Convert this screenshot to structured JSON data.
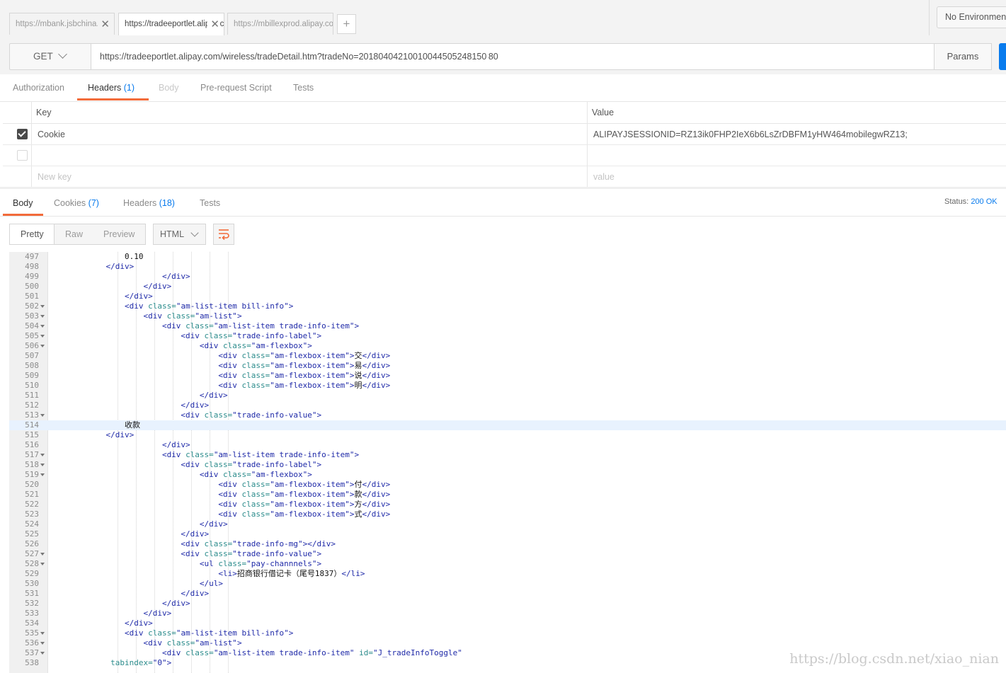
{
  "tabs": [
    {
      "label": "https://mbank.jsbchina.cn"
    },
    {
      "label": "https://tradeeportlet.alipay.com"
    },
    {
      "label": "https://mbillexprod.alipay.com"
    }
  ],
  "new_tab_label": "+",
  "close_glyph": "✕",
  "environment": "No Environment",
  "request": {
    "method": "GET",
    "url": "https://tradeeportlet.alipay.com/wireless/tradeDetail.htm?tradeNo=20180404210010044505248150 80",
    "params_label": "Params"
  },
  "request_tabs": {
    "authorization": "Authorization",
    "headers": "Headers",
    "headers_count": "(1)",
    "body": "Body",
    "prerequest": "Pre-request Script",
    "tests": "Tests"
  },
  "headers_table": {
    "key_header": "Key",
    "value_header": "Value",
    "rows": [
      {
        "key": "Cookie",
        "value": "ALIPAYJSESSIONID=RZ13ik0FHP2IeX6b6LsZrDBFM1yHW464mobilegwRZ13;",
        "checked": true
      }
    ],
    "new_key_placeholder": "New key",
    "value_placeholder": "value"
  },
  "response_tabs": {
    "body": "Body",
    "cookies": "Cookies",
    "cookies_count": "(7)",
    "headers": "Headers",
    "headers_count": "(18)",
    "tests": "Tests"
  },
  "status": {
    "label": "Status:",
    "value": "200 OK"
  },
  "view_modes": [
    "Pretty",
    "Raw",
    "Preview"
  ],
  "language": "HTML",
  "code_lines": [
    {
      "n": "497",
      "f": false,
      "c": [
        [
          "pl",
          "                0.10"
        ]
      ]
    },
    {
      "n": "498",
      "f": false,
      "c": [
        [
          "tg",
          "            </div>"
        ]
      ]
    },
    {
      "n": "499",
      "f": false,
      "c": [
        [
          "tg",
          "                        </div>"
        ]
      ]
    },
    {
      "n": "500",
      "f": false,
      "c": [
        [
          "tg",
          "                    </div>"
        ]
      ]
    },
    {
      "n": "501",
      "f": false,
      "c": [
        [
          "tg",
          "                </div>"
        ]
      ]
    },
    {
      "n": "502",
      "f": true,
      "c": [
        [
          "tg",
          "                <div "
        ],
        [
          "at",
          "class="
        ],
        [
          "st",
          "\"am-list-item bill-info\""
        ],
        [
          "tg",
          ">"
        ]
      ]
    },
    {
      "n": "503",
      "f": true,
      "c": [
        [
          "tg",
          "                    <div "
        ],
        [
          "at",
          "class="
        ],
        [
          "st",
          "\"am-list\""
        ],
        [
          "tg",
          ">"
        ]
      ]
    },
    {
      "n": "504",
      "f": true,
      "c": [
        [
          "tg",
          "                        <div "
        ],
        [
          "at",
          "class="
        ],
        [
          "st",
          "\"am-list-item trade-info-item\""
        ],
        [
          "tg",
          ">"
        ]
      ]
    },
    {
      "n": "505",
      "f": true,
      "c": [
        [
          "tg",
          "                            <div "
        ],
        [
          "at",
          "class="
        ],
        [
          "st",
          "\"trade-info-label\""
        ],
        [
          "tg",
          ">"
        ]
      ]
    },
    {
      "n": "506",
      "f": true,
      "c": [
        [
          "tg",
          "                                <div "
        ],
        [
          "at",
          "class="
        ],
        [
          "st",
          "\"am-flexbox\""
        ],
        [
          "tg",
          ">"
        ]
      ]
    },
    {
      "n": "507",
      "f": false,
      "c": [
        [
          "tg",
          "                                    <div "
        ],
        [
          "at",
          "class="
        ],
        [
          "st",
          "\"am-flexbox-item\""
        ],
        [
          "tg",
          ">"
        ],
        [
          "pl",
          "交"
        ],
        [
          "tg",
          "</div>"
        ]
      ]
    },
    {
      "n": "508",
      "f": false,
      "c": [
        [
          "tg",
          "                                    <div "
        ],
        [
          "at",
          "class="
        ],
        [
          "st",
          "\"am-flexbox-item\""
        ],
        [
          "tg",
          ">"
        ],
        [
          "pl",
          "易"
        ],
        [
          "tg",
          "</div>"
        ]
      ]
    },
    {
      "n": "509",
      "f": false,
      "c": [
        [
          "tg",
          "                                    <div "
        ],
        [
          "at",
          "class="
        ],
        [
          "st",
          "\"am-flexbox-item\""
        ],
        [
          "tg",
          ">"
        ],
        [
          "pl",
          "说"
        ],
        [
          "tg",
          "</div>"
        ]
      ]
    },
    {
      "n": "510",
      "f": false,
      "c": [
        [
          "tg",
          "                                    <div "
        ],
        [
          "at",
          "class="
        ],
        [
          "st",
          "\"am-flexbox-item\""
        ],
        [
          "tg",
          ">"
        ],
        [
          "pl",
          "明"
        ],
        [
          "tg",
          "</div>"
        ]
      ]
    },
    {
      "n": "511",
      "f": false,
      "c": [
        [
          "tg",
          "                                </div>"
        ]
      ]
    },
    {
      "n": "512",
      "f": false,
      "c": [
        [
          "tg",
          "                            </div>"
        ]
      ]
    },
    {
      "n": "513",
      "f": true,
      "c": [
        [
          "tg",
          "                            <div "
        ],
        [
          "at",
          "class="
        ],
        [
          "st",
          "\"trade-info-value\""
        ],
        [
          "tg",
          ">"
        ]
      ]
    },
    {
      "n": "514",
      "f": false,
      "hl": true,
      "c": [
        [
          "pl",
          "                收款"
        ]
      ]
    },
    {
      "n": "515",
      "f": false,
      "c": [
        [
          "tg",
          "            </div>"
        ]
      ]
    },
    {
      "n": "516",
      "f": false,
      "c": [
        [
          "tg",
          "                        </div>"
        ]
      ]
    },
    {
      "n": "517",
      "f": true,
      "c": [
        [
          "tg",
          "                        <div "
        ],
        [
          "at",
          "class="
        ],
        [
          "st",
          "\"am-list-item trade-info-item\""
        ],
        [
          "tg",
          ">"
        ]
      ]
    },
    {
      "n": "518",
      "f": true,
      "c": [
        [
          "tg",
          "                            <div "
        ],
        [
          "at",
          "class="
        ],
        [
          "st",
          "\"trade-info-label\""
        ],
        [
          "tg",
          ">"
        ]
      ]
    },
    {
      "n": "519",
      "f": true,
      "c": [
        [
          "tg",
          "                                <div "
        ],
        [
          "at",
          "class="
        ],
        [
          "st",
          "\"am-flexbox\""
        ],
        [
          "tg",
          ">"
        ]
      ]
    },
    {
      "n": "520",
      "f": false,
      "c": [
        [
          "tg",
          "                                    <div "
        ],
        [
          "at",
          "class="
        ],
        [
          "st",
          "\"am-flexbox-item\""
        ],
        [
          "tg",
          ">"
        ],
        [
          "pl",
          "付"
        ],
        [
          "tg",
          "</div>"
        ]
      ]
    },
    {
      "n": "521",
      "f": false,
      "c": [
        [
          "tg",
          "                                    <div "
        ],
        [
          "at",
          "class="
        ],
        [
          "st",
          "\"am-flexbox-item\""
        ],
        [
          "tg",
          ">"
        ],
        [
          "pl",
          "款"
        ],
        [
          "tg",
          "</div>"
        ]
      ]
    },
    {
      "n": "522",
      "f": false,
      "c": [
        [
          "tg",
          "                                    <div "
        ],
        [
          "at",
          "class="
        ],
        [
          "st",
          "\"am-flexbox-item\""
        ],
        [
          "tg",
          ">"
        ],
        [
          "pl",
          "方"
        ],
        [
          "tg",
          "</div>"
        ]
      ]
    },
    {
      "n": "523",
      "f": false,
      "c": [
        [
          "tg",
          "                                    <div "
        ],
        [
          "at",
          "class="
        ],
        [
          "st",
          "\"am-flexbox-item\""
        ],
        [
          "tg",
          ">"
        ],
        [
          "pl",
          "式"
        ],
        [
          "tg",
          "</div>"
        ]
      ]
    },
    {
      "n": "524",
      "f": false,
      "c": [
        [
          "tg",
          "                                </div>"
        ]
      ]
    },
    {
      "n": "525",
      "f": false,
      "c": [
        [
          "tg",
          "                            </div>"
        ]
      ]
    },
    {
      "n": "526",
      "f": false,
      "c": [
        [
          "tg",
          "                            <div "
        ],
        [
          "at",
          "class="
        ],
        [
          "st",
          "\"trade-info-mg\""
        ],
        [
          "tg",
          "></div>"
        ]
      ]
    },
    {
      "n": "527",
      "f": true,
      "c": [
        [
          "tg",
          "                            <div "
        ],
        [
          "at",
          "class="
        ],
        [
          "st",
          "\"trade-info-value\""
        ],
        [
          "tg",
          ">"
        ]
      ]
    },
    {
      "n": "528",
      "f": true,
      "c": [
        [
          "tg",
          "                                <ul "
        ],
        [
          "at",
          "class="
        ],
        [
          "st",
          "\"pay-channnels\""
        ],
        [
          "tg",
          ">"
        ]
      ]
    },
    {
      "n": "529",
      "f": false,
      "c": [
        [
          "tg",
          "                                    <li>"
        ],
        [
          "pl",
          "招商银行借记卡（尾号1837）"
        ],
        [
          "tg",
          "</li>"
        ]
      ]
    },
    {
      "n": "530",
      "f": false,
      "c": [
        [
          "tg",
          "                                </ul>"
        ]
      ]
    },
    {
      "n": "531",
      "f": false,
      "c": [
        [
          "tg",
          "                            </div>"
        ]
      ]
    },
    {
      "n": "532",
      "f": false,
      "c": [
        [
          "tg",
          "                        </div>"
        ]
      ]
    },
    {
      "n": "533",
      "f": false,
      "c": [
        [
          "tg",
          "                    </div>"
        ]
      ]
    },
    {
      "n": "534",
      "f": false,
      "c": [
        [
          "tg",
          "                </div>"
        ]
      ]
    },
    {
      "n": "535",
      "f": true,
      "c": [
        [
          "tg",
          "                <div "
        ],
        [
          "at",
          "class="
        ],
        [
          "st",
          "\"am-list-item bill-info\""
        ],
        [
          "tg",
          ">"
        ]
      ]
    },
    {
      "n": "536",
      "f": true,
      "c": [
        [
          "tg",
          "                    <div "
        ],
        [
          "at",
          "class="
        ],
        [
          "st",
          "\"am-list\""
        ],
        [
          "tg",
          ">"
        ]
      ]
    },
    {
      "n": "537",
      "f": true,
      "c": [
        [
          "tg",
          "                        <div "
        ],
        [
          "at",
          "class="
        ],
        [
          "st",
          "\"am-list-item trade-info-item\" "
        ],
        [
          "at",
          "id="
        ],
        [
          "st",
          "\"J_tradeInfoToggle\""
        ]
      ]
    },
    {
      "n": "538",
      "f": false,
      "c": [
        [
          "at",
          "             tabindex="
        ],
        [
          "st",
          "\"0\""
        ],
        [
          "tg",
          ">"
        ]
      ]
    }
  ],
  "watermark": "https://blog.csdn.net/xiao_nian"
}
